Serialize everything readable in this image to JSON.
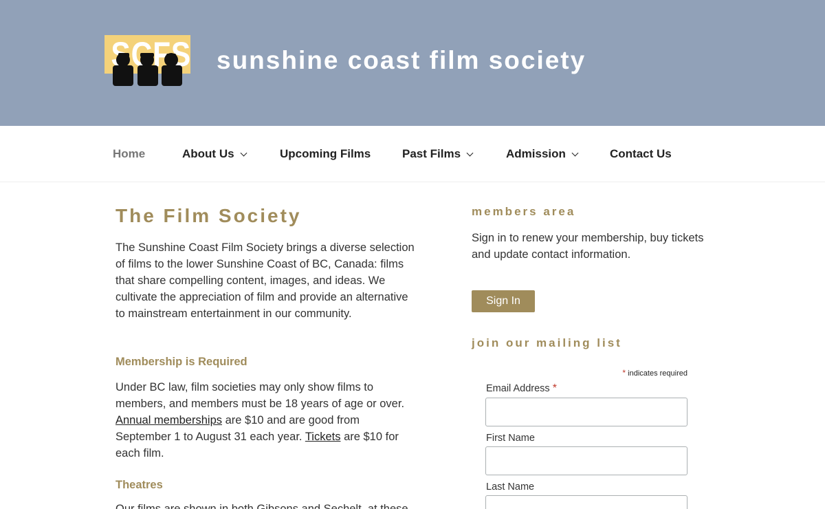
{
  "header": {
    "logo_text": "SCFS",
    "site_title": "sunshine coast film society",
    "colors": {
      "background": "#91a1b8",
      "logo_yellow": "#f4d27a"
    }
  },
  "nav": {
    "items": [
      {
        "label": "Home",
        "current": true,
        "has_dropdown": false
      },
      {
        "label": "About Us",
        "has_dropdown": true
      },
      {
        "label": "Upcoming Films",
        "has_dropdown": false
      },
      {
        "label": "Past Films",
        "has_dropdown": true
      },
      {
        "label": "Admission",
        "has_dropdown": true
      },
      {
        "label": "Contact Us",
        "has_dropdown": false
      }
    ]
  },
  "main": {
    "title": "The Film Society",
    "intro": "The Sunshine Coast Film Society brings a diverse selection of films to the lower Sunshine Coast of BC, Canada: films that share compelling content, images, and ideas. We cultivate the appreciation of film and provide an alternative to mainstream entertainment in our community.",
    "membership_heading": "Membership is Required",
    "membership_text_1": "Under BC law, film societies may only show films to members, and members must be 18 years of age or over.",
    "membership_link_annual": "Annual memberships",
    "membership_text_2": "are $10 and are good from September 1 to August 31 each year.",
    "membership_link_tickets": "Tickets",
    "membership_text_3": "are $10 for each film.",
    "theatres_heading": "Theatres",
    "theatres_text": "Our films are shown in both Gibsons and Sechelt, at these"
  },
  "sidebar": {
    "members_title": "members area",
    "members_text": "Sign in to renew your membership, buy tickets and update contact information.",
    "signin_label": "Sign In",
    "mailing_title": "join our mailing list",
    "required_star": "*",
    "required_note": "indicates required",
    "email_label": "Email Address",
    "first_name_label": "First Name",
    "last_name_label": "Last Name",
    "email_value": "",
    "first_name_value": "",
    "last_name_value": ""
  },
  "colors": {
    "accent": "#a08c5b",
    "nav_current": "#767676",
    "text": "#333333"
  }
}
